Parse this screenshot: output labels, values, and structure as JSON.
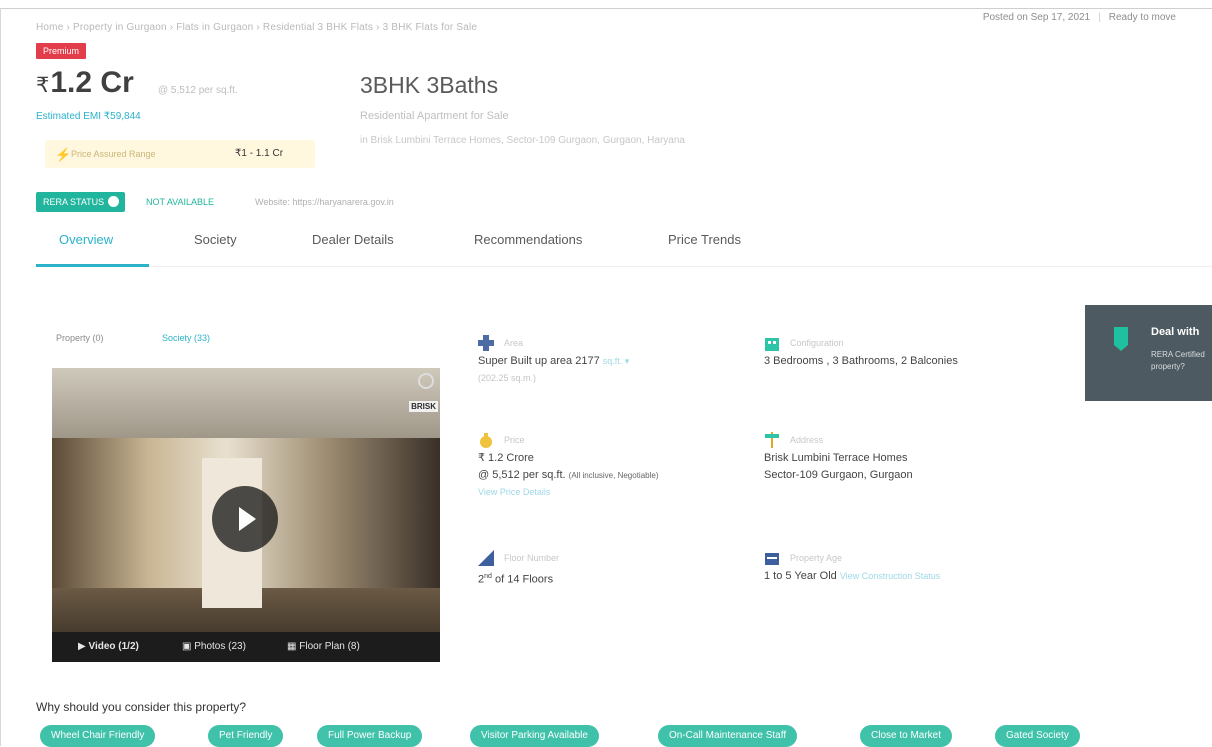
{
  "breadcrumb": "Home › Property in Gurgaon › Flats in Gurgaon › Residential 3 BHK Flats › 3 BHK Flats for Sale",
  "posted": {
    "date": "Posted on Sep 17, 2021",
    "status": "Ready to move"
  },
  "badge": "Premium",
  "price": {
    "currency": "₹",
    "amount": "1.2 Cr",
    "per_sqft": "@ 5,512 per sq.ft.",
    "emi": "Estimated EMI ₹59,844"
  },
  "price_box": {
    "text": "Price Assured Range",
    "value": "₹1 - 1.1 Cr"
  },
  "property": {
    "title": "3BHK 3Baths",
    "subtitle": "Residential Apartment for Sale",
    "address": "in Brisk Lumbini Terrace Homes, Sector-109 Gurgaon, Gurgaon, Haryana"
  },
  "rera": {
    "badge": "RERA STATUS",
    "status": "NOT AVAILABLE",
    "website": "Website: https://haryanarera.gov.in"
  },
  "tabs": [
    "Overview",
    "Society",
    "Dealer Details",
    "Recommendations",
    "Price Trends"
  ],
  "media_tabs": [
    "Property (0)",
    "Society (33)"
  ],
  "gallery": {
    "brand": "BRISK",
    "video": "Video (1/2)",
    "photos": "Photos (23)",
    "floor_plan": "Floor Plan (8)"
  },
  "specs": {
    "area": {
      "label": "Area",
      "line1": "Super Built up area 2177",
      "unit": "sq.ft. ▾",
      "line2": "(202.25 sq.m.)"
    },
    "configuration": {
      "label": "Configuration",
      "value": "3 Bedrooms , 3 Bathrooms, 2 Balconies"
    },
    "price": {
      "label": "Price",
      "line1": "₹ 1.2 Crore",
      "line2": "@ 5,512 per sq.ft.",
      "note": "(All inclusive, Negotiable)",
      "link": "View Price Details"
    },
    "address": {
      "label": "Address",
      "line1": "Brisk Lumbini Terrace Homes",
      "line2": "Sector-109 Gurgaon, Gurgaon"
    },
    "floor": {
      "label": "Floor Number",
      "sup": "nd",
      "num": "2",
      "rest": "of 14 Floors"
    },
    "age": {
      "label": "Property Age",
      "value": "1 to 5 Year Old",
      "link": "View Construction Status"
    }
  },
  "deal_card": {
    "title": "Deal with",
    "text1": "RERA Certified",
    "text2": "property?"
  },
  "why": {
    "heading": "Why should you consider this property?"
  },
  "chips": [
    "Wheel Chair Friendly",
    "Pet Friendly",
    "Full Power Backup",
    "Visitor Parking Available",
    "On-Call Maintenance Staff",
    "Close to Market",
    "Gated Society"
  ],
  "colors": {
    "accent": "#2ab3c9",
    "green": "#20b59c",
    "chip": "#3fc1aa",
    "premium": "#e23d4b"
  }
}
